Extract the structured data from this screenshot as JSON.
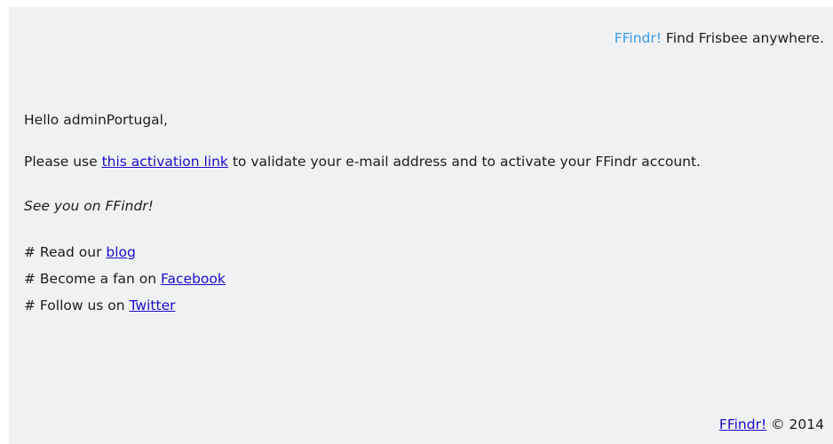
{
  "header": {
    "brand": "FFindr!",
    "tagline": "Find Frisbee anywhere."
  },
  "message": {
    "greeting": "Hello adminPortugal,",
    "para_before": "Please use ",
    "activation_link": "this activation link",
    "para_after": " to validate your e-mail address and to activate your FFindr account.",
    "signoff": "See you on FFindr!"
  },
  "links": [
    {
      "prefix": "# Read our ",
      "label": "blog"
    },
    {
      "prefix": "# Become a fan on ",
      "label": "Facebook"
    },
    {
      "prefix": "# Follow us on ",
      "label": "Twitter"
    }
  ],
  "footer": {
    "brand": "FFindr!",
    "copyright": "© 2014"
  },
  "colors": {
    "background": "#f0f1f2",
    "brand": "#3a9bf0",
    "link": "#1a0dcc",
    "text": "#1c1c1c"
  }
}
